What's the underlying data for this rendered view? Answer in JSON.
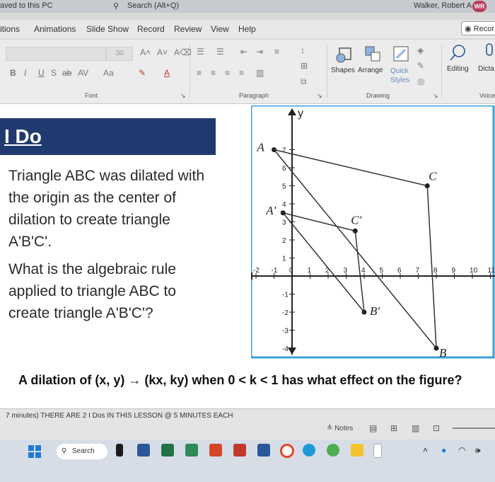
{
  "titlebar": {
    "saved_status": "aved to this PC",
    "search_placeholder": "Search (Alt+Q)",
    "user_name": "Walker, Robert A",
    "user_initials": "WR"
  },
  "tabs": [
    "itions",
    "Animations",
    "Slide Show",
    "Record",
    "Review",
    "View",
    "Help"
  ],
  "record_button": "Recor",
  "ribbon": {
    "font_size": "30",
    "font_group": "Font",
    "paragraph_group": "Paragraph",
    "drawing_group": "Drawing",
    "voice_group": "Voice",
    "shapes_label": "Shapes",
    "arrange_label": "Arrange",
    "quick_styles_label": "Quick Styles",
    "editing_label": "Editing",
    "dictate_label": "Dicta",
    "format_letters": [
      "B",
      "I",
      "U",
      "S",
      "ab",
      "AV",
      "Aa"
    ]
  },
  "slide": {
    "heading": "I Do",
    "question_lines": [
      "Triangle ABC was dilated with",
      "the origin as the center of",
      "dilation to create triangle",
      "A'B'C'.",
      "What is the algebraic rule",
      "applied to triangle ABC to",
      "create triangle A'B'C'?"
    ],
    "caption": "A dilation of (x, y) → (kx, ky) when 0 < k < 1 has what effect on the figure?",
    "graph": {
      "axis_y_label": "y",
      "x_ticks": [
        "-2",
        "-1",
        "0",
        "1",
        "2",
        "3",
        "4",
        "5",
        "6",
        "7",
        "8",
        "9",
        "10",
        "11"
      ],
      "y_ticks": [
        "7",
        "6",
        "5",
        "4",
        "3",
        "2",
        "1",
        "-1",
        "-2",
        "-3",
        "-4"
      ],
      "points": {
        "A": {
          "label": "A",
          "x": -1,
          "y": 7
        },
        "B": {
          "label": "B",
          "x": 8,
          "y": -4
        },
        "C": {
          "label": "C",
          "x": 7.5,
          "y": 5
        },
        "A_prime": {
          "label": "A'",
          "x": -0.5,
          "y": 3.5
        },
        "B_prime": {
          "label": "B'",
          "x": 4,
          "y": -2
        },
        "C_prime": {
          "label": "C'",
          "x": 3.5,
          "y": 2.5
        }
      }
    }
  },
  "status": {
    "message": "7 minutes) THERE ARE 2 I Dos IN THIS LESSON @ 5 MINUTES EACH",
    "notes_label": "Notes"
  },
  "taskbar": {
    "search_label": "Search"
  }
}
